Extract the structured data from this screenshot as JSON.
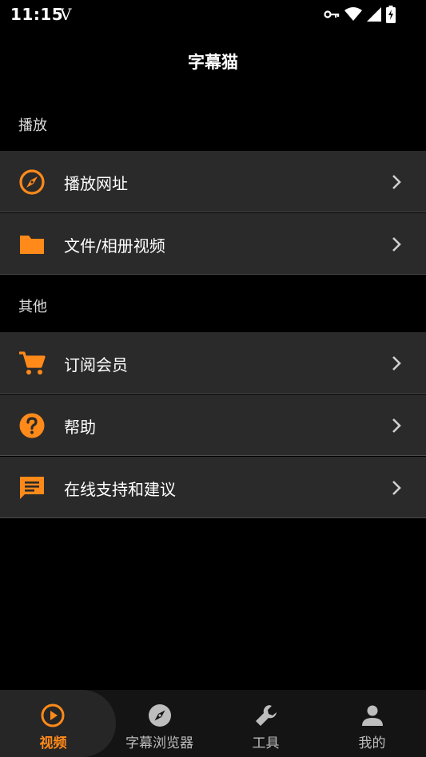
{
  "status_bar": {
    "time": "11:15",
    "carrier_glyph": "V",
    "icons": [
      "key-icon",
      "wifi-icon",
      "signal-icon",
      "battery-charging-icon"
    ]
  },
  "header": {
    "title": "字幕猫"
  },
  "sections": [
    {
      "label": "播放",
      "items": [
        {
          "label": "播放网址",
          "icon": "compass-icon"
        },
        {
          "label": "文件/相册视频",
          "icon": "folder-icon"
        }
      ]
    },
    {
      "label": "其他",
      "items": [
        {
          "label": "订阅会员",
          "icon": "cart-icon"
        },
        {
          "label": "帮助",
          "icon": "help-icon"
        },
        {
          "label": "在线支持和建议",
          "icon": "message-icon"
        }
      ]
    }
  ],
  "bottom_nav": [
    {
      "label": "视频",
      "icon": "play-circle-icon",
      "active": true
    },
    {
      "label": "字幕浏览器",
      "icon": "compass-icon",
      "active": false
    },
    {
      "label": "工具",
      "icon": "wrench-icon",
      "active": false
    },
    {
      "label": "我的",
      "icon": "person-icon",
      "active": false
    }
  ],
  "colors": {
    "accent": "#ff8a1a",
    "row_bg": "#2a2a2a",
    "background": "#000000"
  }
}
